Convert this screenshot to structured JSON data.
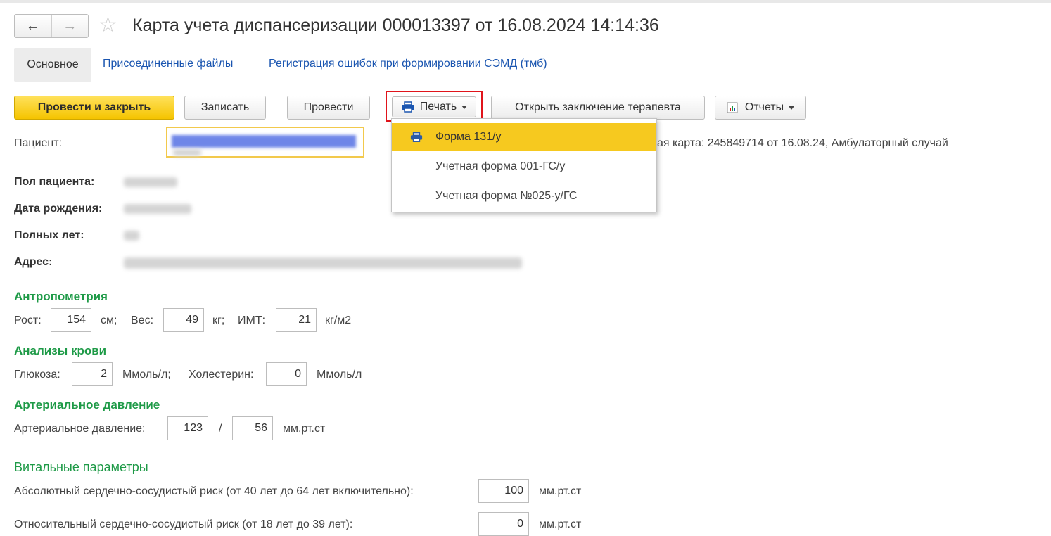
{
  "window": {
    "title": "Карта учета диспансеризации 000013397 от 16.08.2024 14:14:36",
    "back_symbol": "←",
    "forward_symbol": "→",
    "star_symbol": "☆"
  },
  "tabs": {
    "main": "Основное",
    "files": "Присоединенные файлы",
    "errors": "Регистрация ошибок при формировании СЭМД (тмб)"
  },
  "toolbar": {
    "post_close": "Провести и закрыть",
    "save": "Записать",
    "post": "Провести",
    "print": "Печать",
    "open_conclusion": "Открыть заключение терапевта",
    "reports": "Отчеты"
  },
  "print_menu": {
    "items": [
      "Форма 131/у",
      "Учетная форма 001-ГС/у",
      "Учетная форма №025-у/ГС"
    ],
    "active_index": 0
  },
  "patient": {
    "label": "Пациент:",
    "card_info": "ая карта: 245849714 от 16.08.24, Амбулаторный случай",
    "gender_label": "Пол пациента:",
    "birth_label": "Дата рождения:",
    "age_label": "Полных лет:",
    "address_label": "Адрес:"
  },
  "anthropometry": {
    "title": "Антропометрия",
    "height_label": "Рост:",
    "height_value": "154",
    "height_unit": "см;",
    "weight_label": "Вес:",
    "weight_value": "49",
    "weight_unit": "кг;",
    "bmi_label": "ИМТ:",
    "bmi_value": "21",
    "bmi_unit": "кг/м2"
  },
  "blood": {
    "title": "Анализы крови",
    "glucose_label": "Глюкоза:",
    "glucose_value": "2",
    "glucose_unit": "Ммоль/л;",
    "chol_label": "Холестерин:",
    "chol_value": "0",
    "chol_unit": "Ммоль/л"
  },
  "pressure": {
    "title": "Артериальное давление",
    "label": "Артериальное давление:",
    "systolic": "123",
    "separator": "/",
    "diastolic": "56",
    "unit": "мм.рт.ст"
  },
  "vitals": {
    "title": "Витальные параметры",
    "abs_risk_label": "Абсолютный сердечно-сосудистый риск (от 40 лет до 64 лет включительно):",
    "abs_risk_value": "100",
    "abs_risk_unit": "мм.рт.ст",
    "rel_risk_label": "Относительный сердечно-сосудистый риск (от 18 лет до 39 лет):",
    "rel_risk_value": "0",
    "rel_risk_unit": "мм.рт.ст"
  },
  "colors": {
    "accent_yellow": "#f5c400",
    "section_green": "#1e9a47",
    "link_blue": "#1a55b0",
    "highlight_red": "#e0141b"
  }
}
